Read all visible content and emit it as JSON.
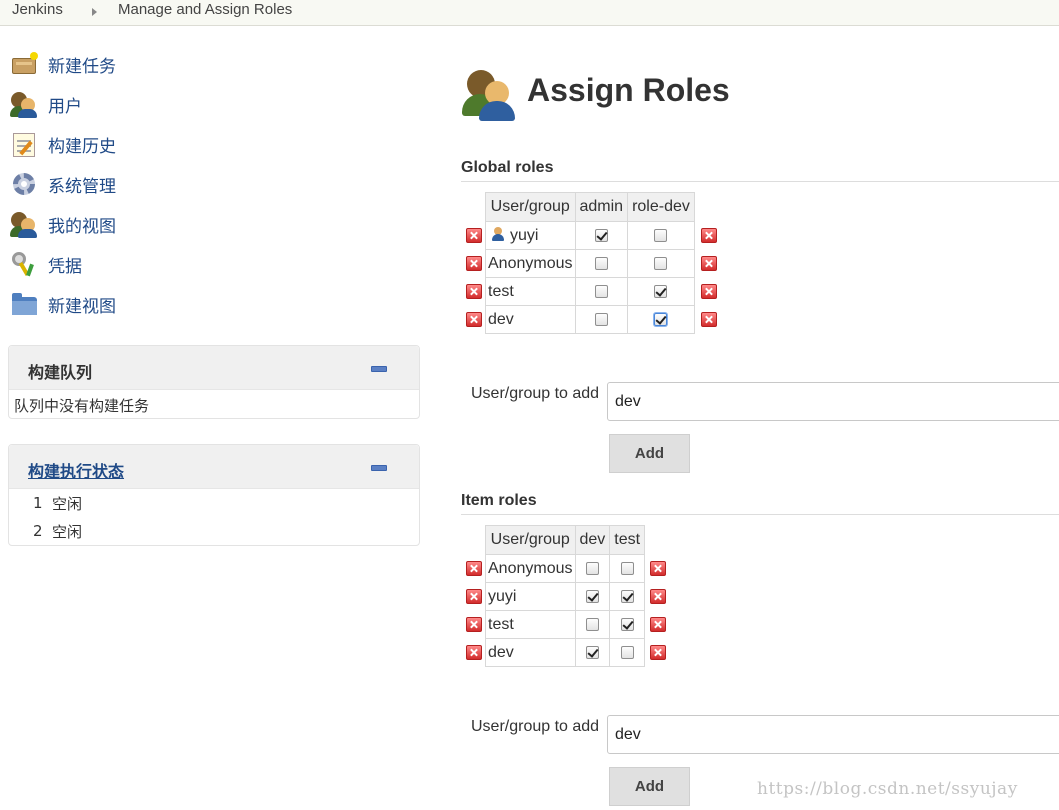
{
  "breadcrumb": {
    "root": "Jenkins",
    "page": "Manage and Assign Roles"
  },
  "sidebar": {
    "items": [
      {
        "label": "新建任务",
        "icon": "new-item-icon"
      },
      {
        "label": "用户",
        "icon": "users-icon"
      },
      {
        "label": "构建历史",
        "icon": "build-history-icon"
      },
      {
        "label": "系统管理",
        "icon": "gear-icon"
      },
      {
        "label": "我的视图",
        "icon": "my-views-icon"
      },
      {
        "label": "凭据",
        "icon": "credentials-icon"
      },
      {
        "label": "新建视图",
        "icon": "folder-icon"
      }
    ]
  },
  "build_queue": {
    "title": "构建队列",
    "empty_message": "队列中没有构建任务"
  },
  "executors": {
    "title": "构建执行状态",
    "rows": [
      {
        "num": "1",
        "status": "空闲"
      },
      {
        "num": "2",
        "status": "空闲"
      }
    ]
  },
  "main": {
    "title": "Assign Roles",
    "global": {
      "section_title": "Global roles",
      "columns": [
        "User/group",
        "admin",
        "role-dev"
      ],
      "rows": [
        {
          "user": "yuyi",
          "checks": [
            true,
            false
          ],
          "has_icon": true
        },
        {
          "user": "Anonymous",
          "checks": [
            false,
            false
          ]
        },
        {
          "user": "test",
          "checks": [
            false,
            true
          ]
        },
        {
          "user": "dev",
          "checks": [
            false,
            true
          ]
        }
      ],
      "add_label": "User/group to add",
      "add_value": "dev",
      "add_button": "Add"
    },
    "item": {
      "section_title": "Item roles",
      "columns": [
        "User/group",
        "dev",
        "test"
      ],
      "rows": [
        {
          "user": "Anonymous",
          "checks": [
            false,
            false
          ]
        },
        {
          "user": "yuyi",
          "checks": [
            true,
            true
          ]
        },
        {
          "user": "test",
          "checks": [
            false,
            true
          ]
        },
        {
          "user": "dev",
          "checks": [
            true,
            false
          ]
        }
      ],
      "add_label": "User/group to add",
      "add_value": "dev",
      "add_button": "Add"
    }
  },
  "watermark": "https://blog.csdn.net/ssyujay"
}
